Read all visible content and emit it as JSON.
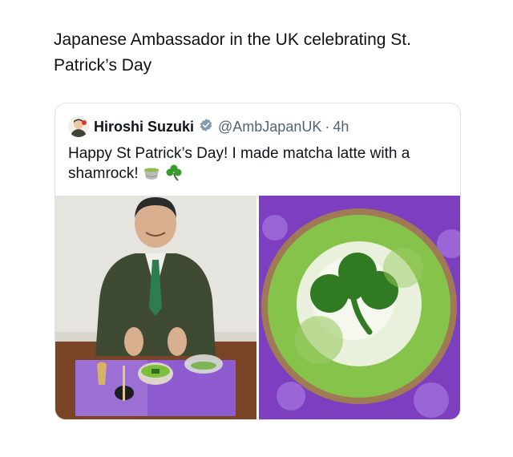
{
  "caption": "Japanese Ambassador in the UK celebrating St. Patrick’s Day",
  "post": {
    "author_name": "Hiroshi Suzuki",
    "verified_badge_icon": "verified-badge-icon",
    "handle": "@AmbJapanUK",
    "separator": "·",
    "age": "4h",
    "text": "Happy St Patrick’s Day! I made matcha latte with a shamrock!",
    "emojis": [
      "matcha-cup-icon",
      "shamrock-icon"
    ]
  },
  "media": {
    "left_photo": "ambassador-matcha-photo",
    "right_photo": "shamrock-latte-photo"
  },
  "colors": {
    "verified": "#829aab",
    "muted": "#536471",
    "matcha": "#7bbf3a",
    "shamrock": "#2f6e1f",
    "tablecloth": "#8e5bd0"
  }
}
